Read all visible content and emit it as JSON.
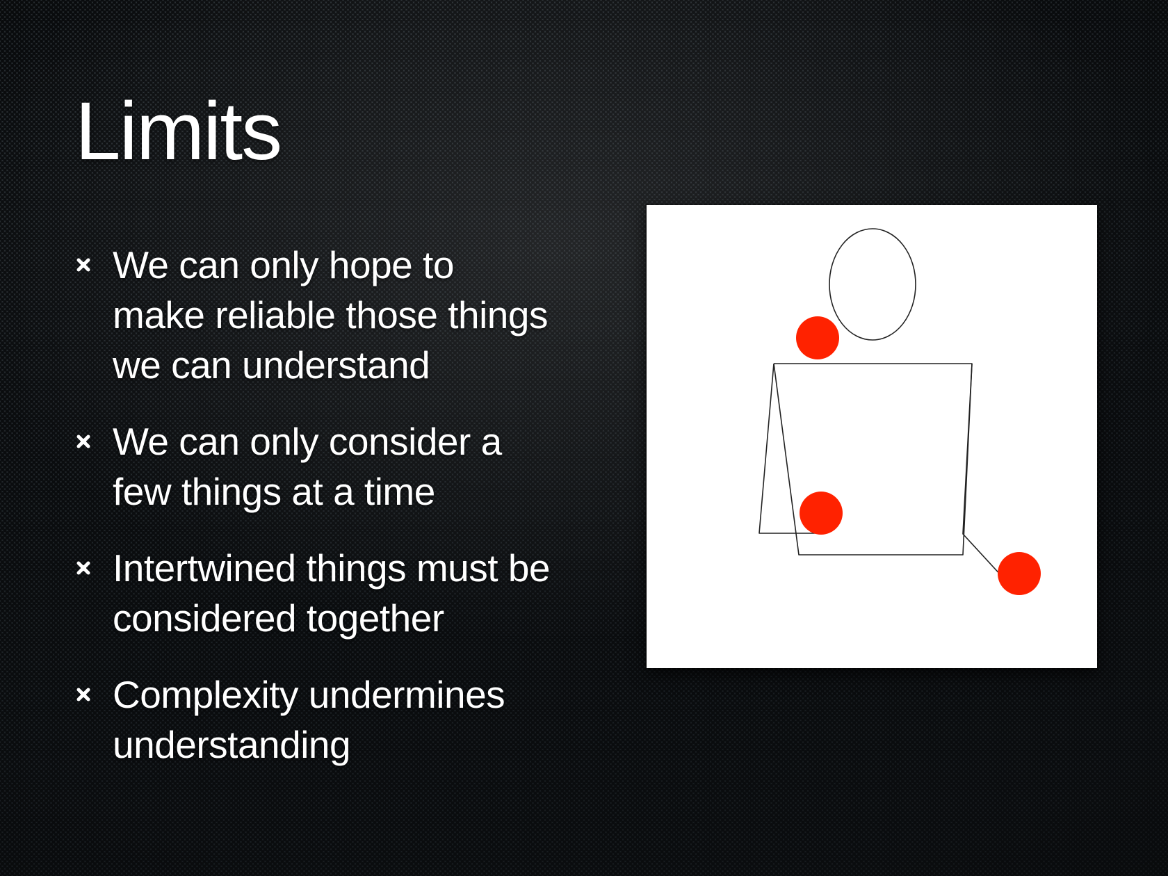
{
  "slide": {
    "title": "Limits",
    "bullets": [
      {
        "lines": [
          "We can only hope to",
          "make reliable those things",
          "we can understand"
        ]
      },
      {
        "lines": [
          "We can only consider a",
          "few things at a time"
        ]
      },
      {
        "lines": [
          "Intertwined things must be",
          "considered together"
        ]
      },
      {
        "lines": [
          "Complexity undermines",
          "understanding"
        ]
      }
    ],
    "bullet_icon": "asterisk-bullet-icon"
  },
  "figure": {
    "subject": "juggler-figure",
    "ball_count": 3
  },
  "colors": {
    "background": "#1e2326",
    "text": "#ffffff",
    "figure_background": "#ffffff",
    "figure_stroke": "#222222",
    "ball": "#ff2200"
  }
}
